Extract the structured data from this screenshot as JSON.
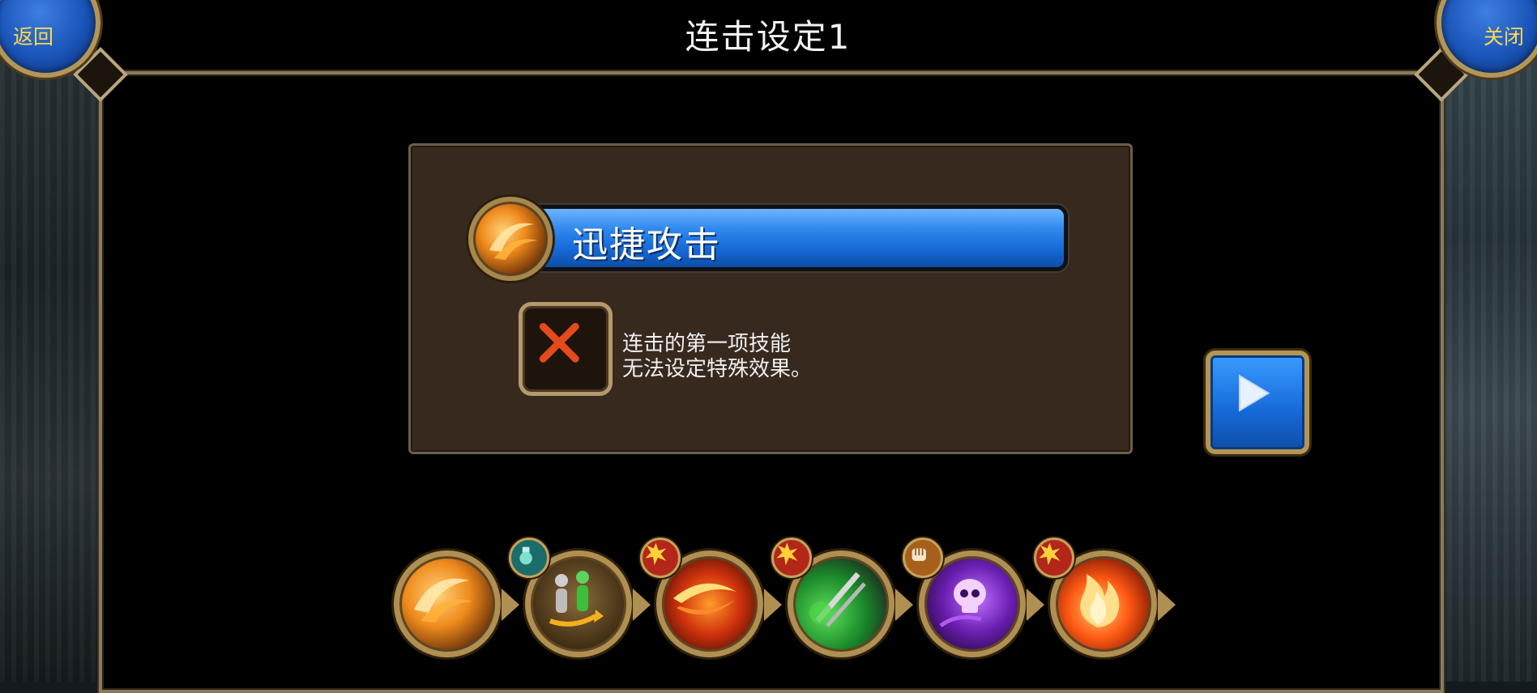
{
  "header": {
    "title": "连击设定1",
    "back_label": "返回",
    "close_label": "关闭"
  },
  "selected_skill": {
    "name": "迅捷攻击",
    "icon": "swift-attack-icon"
  },
  "effect_slot": {
    "icon": "red-x-icon",
    "note_line1": "连击的第一项技能",
    "note_line2": "无法设定特殊效果。"
  },
  "next_button": {
    "icon": "play-arrow-icon"
  },
  "skill_slots": [
    {
      "icon": "swift-attack-icon",
      "badge": ""
    },
    {
      "icon": "swap-figures-icon",
      "badge": "potion-badge-icon"
    },
    {
      "icon": "fire-slash-icon",
      "badge": "burst-badge-icon"
    },
    {
      "icon": "blades-icon",
      "badge": "burst-badge-icon"
    },
    {
      "icon": "skull-icon",
      "badge": "fist-badge-icon"
    },
    {
      "icon": "flame-icon",
      "badge": "burst-badge-icon"
    }
  ],
  "colors": {
    "accent_blue": "#1f78e6",
    "gold_frame": "#b39656",
    "button_text": "#ffd84a",
    "panel_brown": "#38291f"
  }
}
